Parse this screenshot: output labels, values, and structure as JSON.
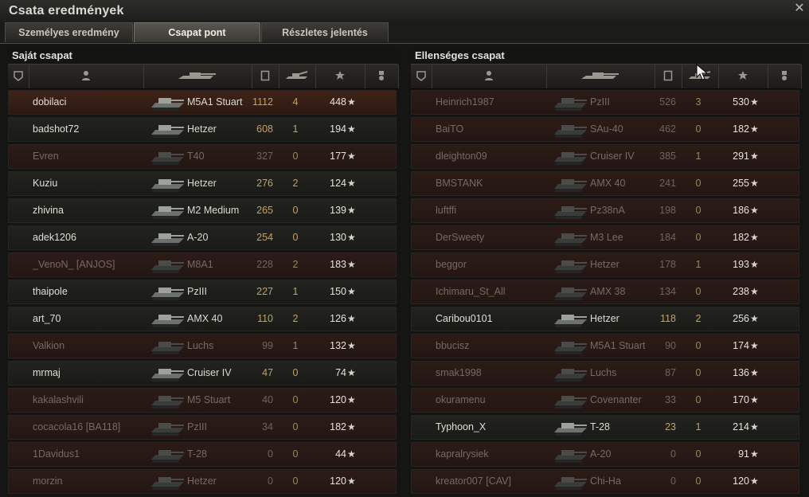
{
  "window": {
    "title": "Csata eredmények",
    "close_icon": "close-icon"
  },
  "tabs": [
    {
      "label": "Személyes eredmény",
      "active": false
    },
    {
      "label": "Csapat pont",
      "active": true
    },
    {
      "label": "Részletes jelentés",
      "active": false
    }
  ],
  "columns": [
    {
      "name": "squad",
      "icon": "squad-icon"
    },
    {
      "name": "player",
      "icon": "player-icon"
    },
    {
      "name": "vehicle",
      "icon": "tank-icon"
    },
    {
      "name": "xp",
      "icon": "xp-shield-icon"
    },
    {
      "name": "kills",
      "icon": "destroyed-tank-icon"
    },
    {
      "name": "points",
      "icon": "star-icon"
    },
    {
      "name": "medal",
      "icon": "medal-icon"
    }
  ],
  "teams": [
    {
      "title": "Saját csapat",
      "rows": [
        {
          "player": "dobilaci",
          "tank": "M5A1 Stuart",
          "xp": "1112",
          "kills": "4",
          "points": "448",
          "status": "first"
        },
        {
          "player": "badshot72",
          "tank": "Hetzer",
          "xp": "608",
          "kills": "1",
          "points": "194",
          "status": "alive"
        },
        {
          "player": "Evren",
          "tank": "T40",
          "xp": "327",
          "kills": "0",
          "points": "177",
          "status": "dead"
        },
        {
          "player": "Kuziu",
          "tank": "Hetzer",
          "xp": "276",
          "kills": "2",
          "points": "124",
          "status": "alive"
        },
        {
          "player": "zhivina",
          "tank": "M2 Medium",
          "xp": "265",
          "kills": "0",
          "points": "139",
          "status": "alive"
        },
        {
          "player": "adek1206",
          "tank": "A-20",
          "xp": "254",
          "kills": "0",
          "points": "130",
          "status": "alive"
        },
        {
          "player": "_VenoN_ [ANJOS]",
          "tank": "M8A1",
          "xp": "228",
          "kills": "2",
          "points": "183",
          "status": "dead"
        },
        {
          "player": "thaipole",
          "tank": "PzIII",
          "xp": "227",
          "kills": "1",
          "points": "150",
          "status": "alive"
        },
        {
          "player": "art_70",
          "tank": "AMX 40",
          "xp": "110",
          "kills": "2",
          "points": "126",
          "status": "alive"
        },
        {
          "player": "Valkion",
          "tank": "Luchs",
          "xp": "99",
          "kills": "1",
          "points": "132",
          "status": "dead"
        },
        {
          "player": "mrmaj",
          "tank": "Cruiser IV",
          "xp": "47",
          "kills": "0",
          "points": "74",
          "status": "alive"
        },
        {
          "player": "kakalashvili",
          "tank": "M5 Stuart",
          "xp": "40",
          "kills": "0",
          "points": "120",
          "status": "dead"
        },
        {
          "player": "cocacola16 [BA118]",
          "tank": "PzIII",
          "xp": "34",
          "kills": "0",
          "points": "182",
          "status": "dead"
        },
        {
          "player": "1Davidus1",
          "tank": "T-28",
          "xp": "0",
          "kills": "0",
          "points": "44",
          "status": "dead"
        },
        {
          "player": "morzin",
          "tank": "Hetzer",
          "xp": "0",
          "kills": "0",
          "points": "120",
          "status": "dead"
        }
      ]
    },
    {
      "title": "Ellenséges csapat",
      "rows": [
        {
          "player": "Heinrich1987",
          "tank": "PzIII",
          "xp": "526",
          "kills": "3",
          "points": "530",
          "status": "dead"
        },
        {
          "player": "BaiTO",
          "tank": "SAu-40",
          "xp": "462",
          "kills": "0",
          "points": "182",
          "status": "dead"
        },
        {
          "player": "dleighton09",
          "tank": "Cruiser IV",
          "xp": "385",
          "kills": "1",
          "points": "291",
          "status": "dead"
        },
        {
          "player": "BMSTANK",
          "tank": "AMX 40",
          "xp": "241",
          "kills": "0",
          "points": "255",
          "status": "dead"
        },
        {
          "player": "luftffi",
          "tank": "Pz38nA",
          "xp": "198",
          "kills": "0",
          "points": "186",
          "status": "dead"
        },
        {
          "player": "DerSweety",
          "tank": "M3 Lee",
          "xp": "184",
          "kills": "0",
          "points": "182",
          "status": "dead"
        },
        {
          "player": "beggor",
          "tank": "Hetzer",
          "xp": "178",
          "kills": "1",
          "points": "193",
          "status": "dead"
        },
        {
          "player": "Ichimaru_St_All",
          "tank": "AMX 38",
          "xp": "134",
          "kills": "0",
          "points": "238",
          "status": "dead"
        },
        {
          "player": "Caribou0101",
          "tank": "Hetzer",
          "xp": "118",
          "kills": "2",
          "points": "256",
          "status": "alive"
        },
        {
          "player": "bbucisz",
          "tank": "M5A1 Stuart",
          "xp": "90",
          "kills": "0",
          "points": "174",
          "status": "dead"
        },
        {
          "player": "smak1998",
          "tank": "Luchs",
          "xp": "87",
          "kills": "0",
          "points": "136",
          "status": "dead"
        },
        {
          "player": "okuramenu",
          "tank": "Covenanter",
          "xp": "33",
          "kills": "0",
          "points": "170",
          "status": "dead"
        },
        {
          "player": "Typhoon_X",
          "tank": "T-28",
          "xp": "23",
          "kills": "1",
          "points": "214",
          "status": "alive"
        },
        {
          "player": "kapralrysiek",
          "tank": "A-20",
          "xp": "0",
          "kills": "0",
          "points": "91",
          "status": "dead"
        },
        {
          "player": "kreator007 [CAV]",
          "tank": "Chi-Ha",
          "xp": "0",
          "kills": "0",
          "points": "120",
          "status": "dead"
        }
      ]
    }
  ]
}
